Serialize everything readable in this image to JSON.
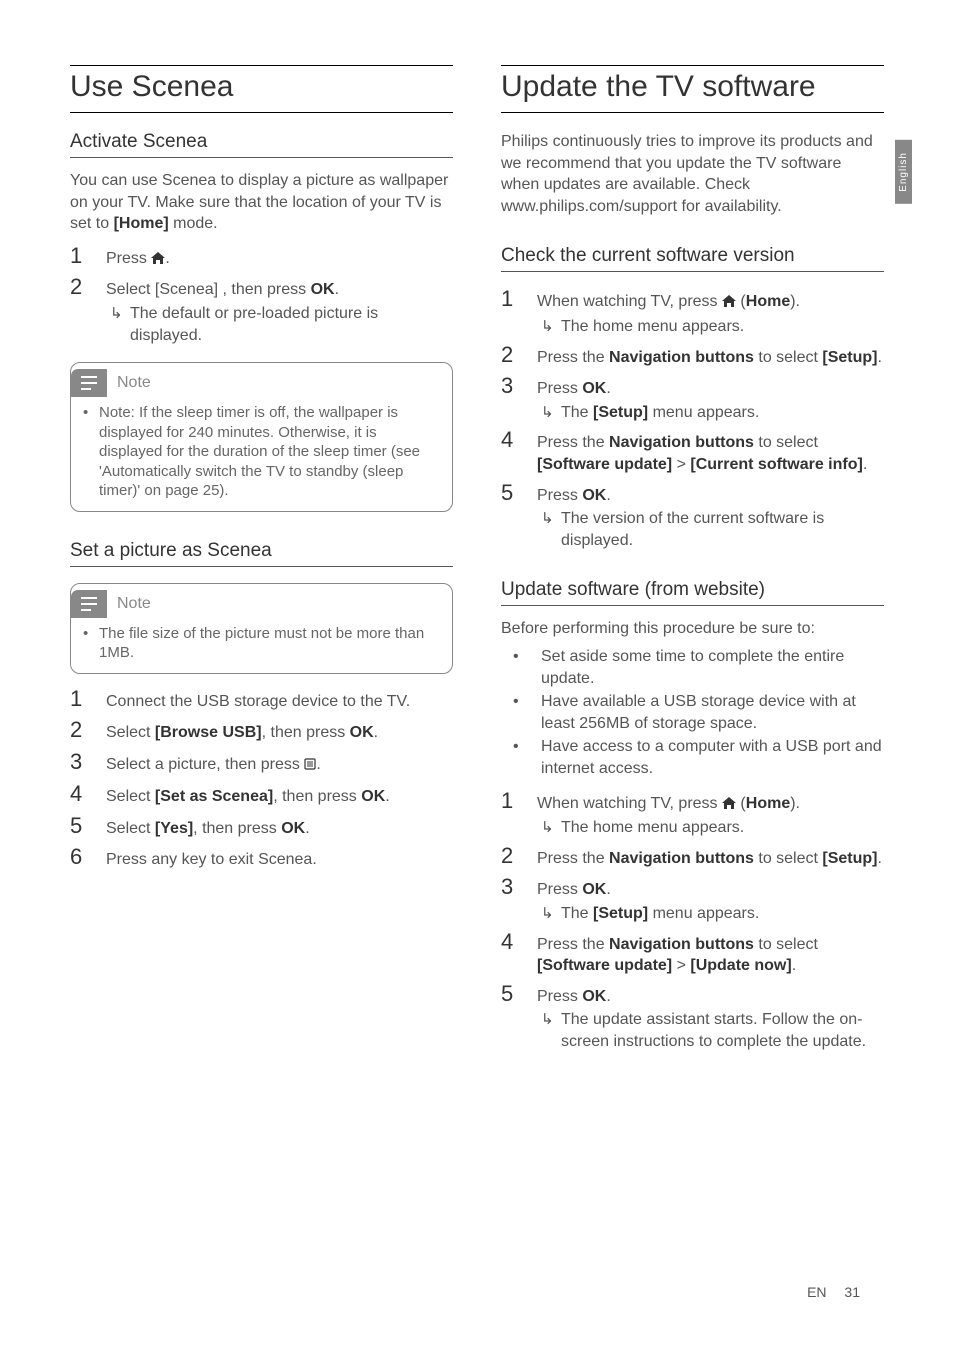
{
  "sidetab": "English",
  "footer": {
    "lang": "EN",
    "page": "31"
  },
  "left": {
    "h1": "Use Scenea",
    "sec1": {
      "h2": "Activate Scenea",
      "intro": "You can use Scenea to display a picture as wallpaper on your TV. Make sure that the location of your TV is set to ",
      "intro_bold": "[Home]",
      "intro_tail": " mode.",
      "steps": [
        {
          "pre": "Press ",
          "icon": "home",
          "post": "."
        },
        {
          "pre": "Select [Scenea] , then press ",
          "bold": "OK",
          "post": ".",
          "sub": "The default or pre-loaded picture is displayed."
        }
      ],
      "note": {
        "title": "Note",
        "text": "Note: If the sleep timer is off, the wallpaper is displayed for 240 minutes. Otherwise, it is displayed for the duration of the sleep timer (see 'Automatically switch the TV to standby (sleep timer)' on page 25)."
      }
    },
    "sec2": {
      "h2": "Set a picture as Scenea",
      "note": {
        "title": "Note",
        "text": "The file size of the picture must not be more than 1MB."
      },
      "steps": [
        {
          "text": "Connect the USB storage device to the TV."
        },
        {
          "pre": "Select ",
          "bold1": "[Browse USB]",
          "mid": ", then press ",
          "bold2": "OK",
          "post": "."
        },
        {
          "pre": "Select a picture, then press ",
          "icon": "options",
          "post": "."
        },
        {
          "pre": "Select ",
          "bold1": "[Set as Scenea]",
          "mid": ", then press ",
          "bold2": "OK",
          "post": "."
        },
        {
          "pre": "Select ",
          "bold1": "[Yes]",
          "mid": ", then press ",
          "bold2": "OK",
          "post": "."
        },
        {
          "text": "Press any key to exit Scenea."
        }
      ]
    }
  },
  "right": {
    "h1": "Update the TV software",
    "intro": "Philips continuously tries to improve its products and we recommend that you update the TV software when updates are available. Check www.philips.com/support for availability.",
    "sec1": {
      "h2": "Check the current software version",
      "steps": [
        {
          "pre": "When watching TV, press ",
          "icon": "home",
          "mid": " (",
          "bold": "Home",
          "post": ").",
          "sub": "The home menu appears."
        },
        {
          "pre": "Press the ",
          "bold": "Navigation buttons",
          "mid": " to select ",
          "bold2": "[Setup]",
          "post": "."
        },
        {
          "pre": "Press ",
          "bold": "OK",
          "post": ".",
          "sub_pre": "The ",
          "sub_bold": "[Setup]",
          "sub_post": " menu appears."
        },
        {
          "pre": "Press the ",
          "bold": "Navigation buttons",
          "mid": " to select ",
          "bold2": "[Software update]",
          "mid2": " > ",
          "bold3": "[Current software info]",
          "post": "."
        },
        {
          "pre": "Press ",
          "bold": "OK",
          "post": ".",
          "sub": "The version of the current software is displayed."
        }
      ]
    },
    "sec2": {
      "h2": "Update software (from website)",
      "intro": "Before performing this procedure be sure to:",
      "bullets": [
        "Set aside some time to complete the entire update.",
        "Have available a USB storage device with at least 256MB of storage space.",
        "Have access to a computer with a USB port and internet access."
      ],
      "steps": [
        {
          "pre": "When watching TV, press ",
          "icon": "home",
          "mid": " (",
          "bold": "Home",
          "post": ").",
          "sub": "The home menu appears."
        },
        {
          "pre": "Press the ",
          "bold": "Navigation buttons",
          "mid": " to select ",
          "bold2": "[Setup]",
          "post": "."
        },
        {
          "pre": "Press ",
          "bold": "OK",
          "post": ".",
          "sub_pre": "The ",
          "sub_bold": "[Setup]",
          "sub_post": " menu appears."
        },
        {
          "pre": "Press the ",
          "bold": "Navigation buttons",
          "mid": " to select ",
          "bold2": "[Software update]",
          "mid2": " > ",
          "bold3": "[Update now]",
          "post": "."
        },
        {
          "pre": "Press ",
          "bold": "OK",
          "post": ".",
          "sub": "The update assistant starts. Follow the on-screen instructions to complete the update."
        }
      ]
    }
  }
}
